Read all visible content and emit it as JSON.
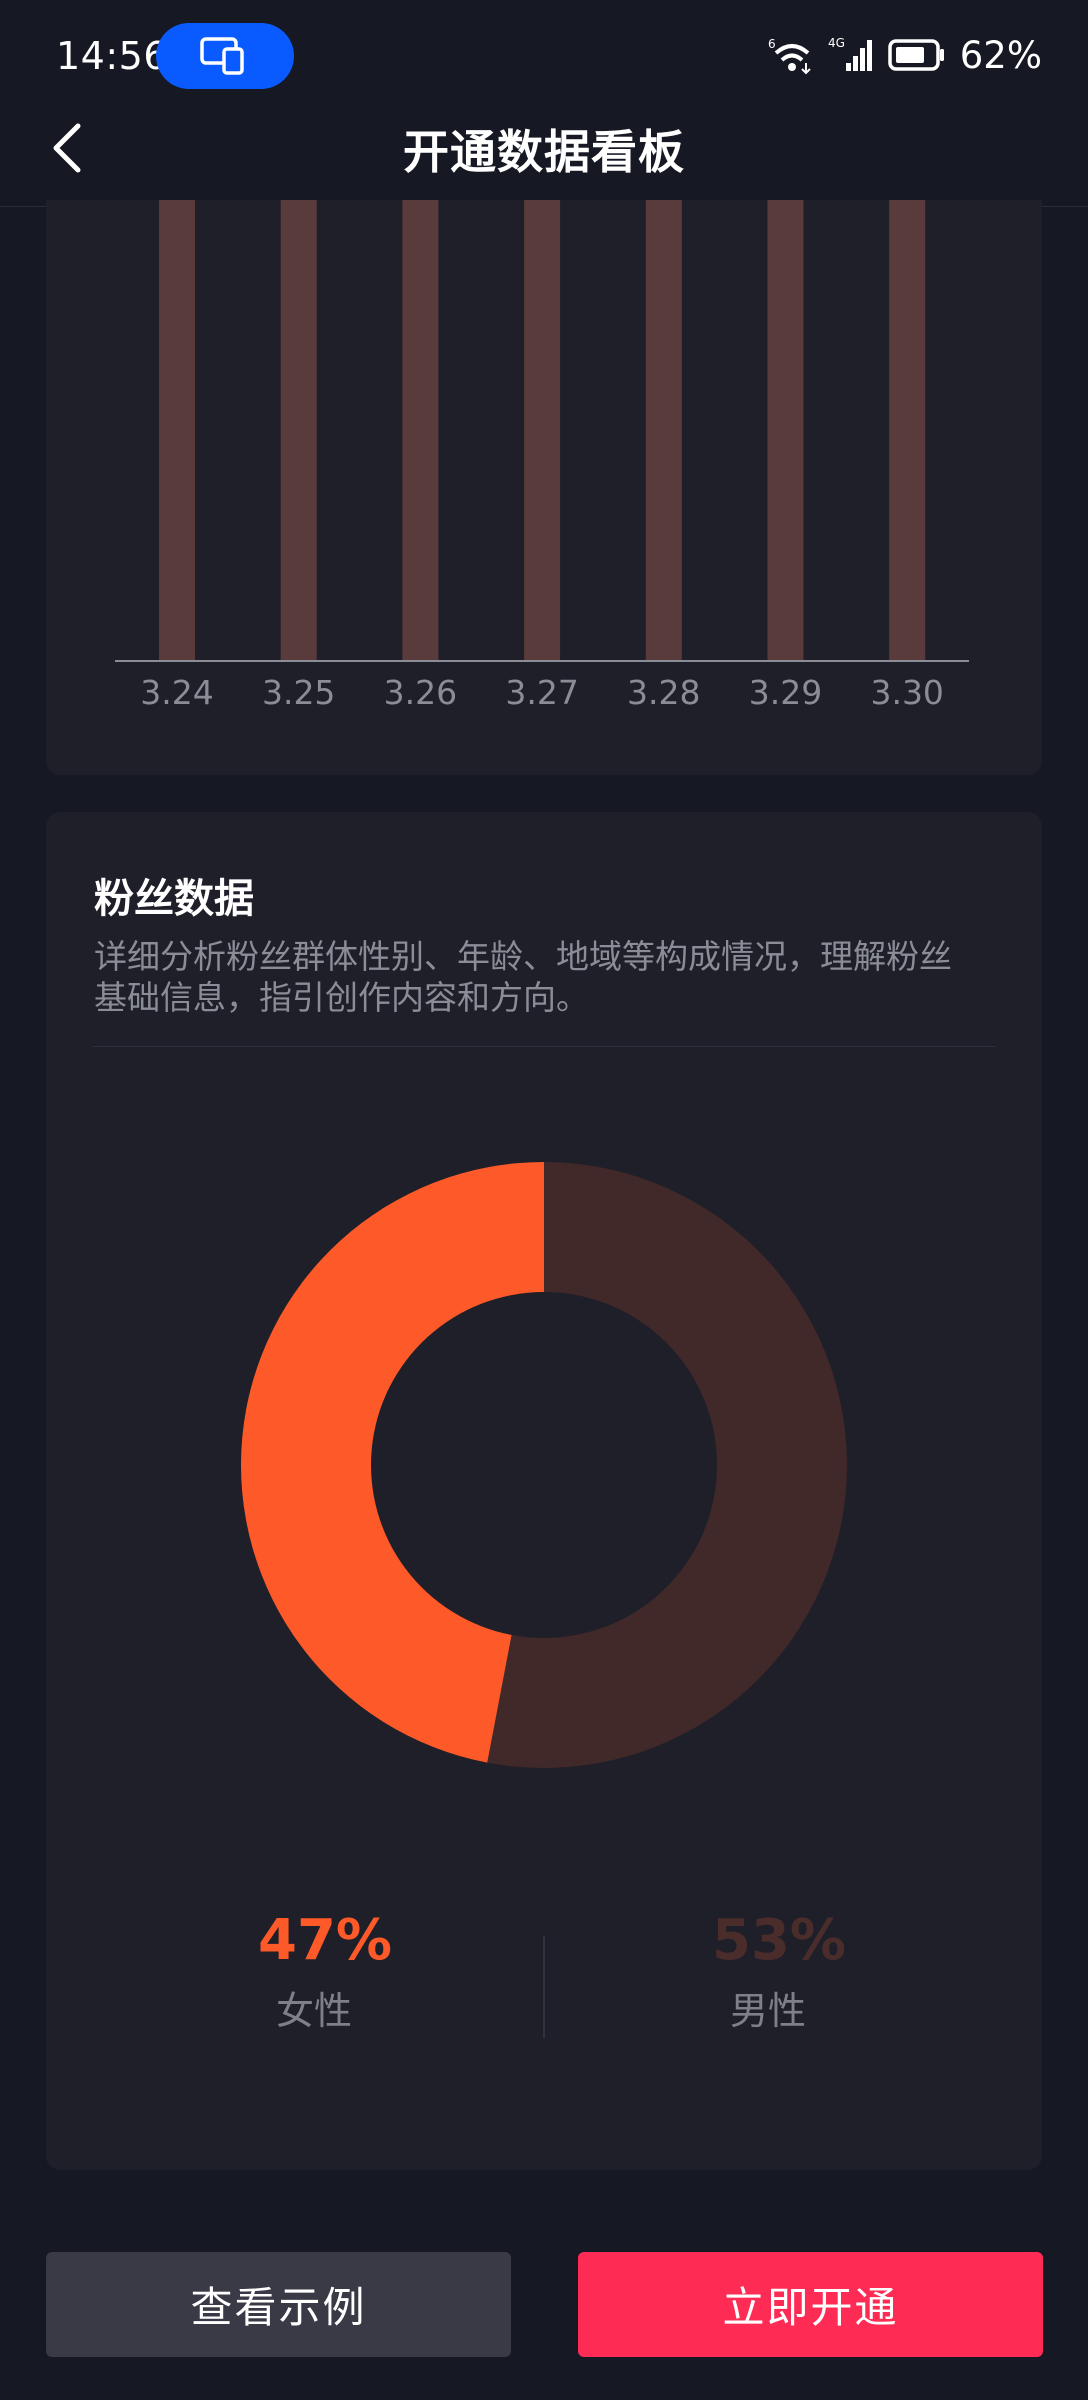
{
  "status_bar": {
    "time": "14:56",
    "battery": "62%",
    "wifi_badge": "6",
    "signal_badge": "4G"
  },
  "header": {
    "title": "开通数据看板"
  },
  "bar_chart": {
    "chart_data": {
      "type": "bar",
      "categories": [
        "3.24",
        "3.25",
        "3.26",
        "3.27",
        "3.28",
        "3.29",
        "3.30"
      ],
      "bar_color": "#5a3b3b"
    }
  },
  "fans": {
    "title": "粉丝数据",
    "description": "详细分析粉丝群体性别、年龄、地域等构成情况，理解粉丝基础信息，指引创作内容和方向。",
    "chart_data": {
      "type": "pie",
      "donut": true,
      "slices": [
        {
          "label": "女性",
          "value": 47,
          "color": "#fe5a29"
        },
        {
          "label": "男性",
          "value": 53,
          "color": "#412829"
        }
      ]
    },
    "female": {
      "value": "47%",
      "label": "女性"
    },
    "male": {
      "value": "53%",
      "label": "男性"
    }
  },
  "buttons": {
    "example": "查看示例",
    "open": "立即开通"
  },
  "colors": {
    "accent": "#fe2c55",
    "female": "#fe5a29",
    "male": "#4a2c2b",
    "background": "#161823",
    "card": "#1e1f29"
  }
}
